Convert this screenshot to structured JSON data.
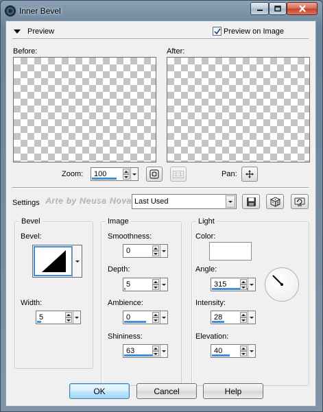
{
  "window": {
    "title": "Inner Bevel"
  },
  "preview": {
    "section_label": "Preview",
    "preview_on_image_label": "Preview on Image",
    "preview_on_image_checked": true,
    "before_label": "Before:",
    "after_label": "After:",
    "zoom_label": "Zoom:",
    "zoom_value": "100",
    "pan_label": "Pan:",
    "ratio_button_label": "1:1"
  },
  "settings": {
    "label": "Settings",
    "preset_value": "Last Used",
    "watermark": "Arte by Neusa Novaes"
  },
  "bevel_group": {
    "title": "Bevel",
    "bevel_label": "Bevel:",
    "width_label": "Width:",
    "width_value": "5"
  },
  "image_group": {
    "title": "Image",
    "smoothness_label": "Smoothness:",
    "smoothness_value": "0",
    "depth_label": "Depth:",
    "depth_value": "5",
    "ambience_label": "Ambience:",
    "ambience_value": "0",
    "shininess_label": "Shininess:",
    "shininess_value": "63"
  },
  "light_group": {
    "title": "Light",
    "color_label": "Color:",
    "color_value": "#ffffff",
    "angle_label": "Angle:",
    "angle_value": "315",
    "intensity_label": "Intensity:",
    "intensity_value": "28",
    "elevation_label": "Elevation:",
    "elevation_value": "40"
  },
  "buttons": {
    "ok": "OK",
    "cancel": "Cancel",
    "help": "Help"
  }
}
